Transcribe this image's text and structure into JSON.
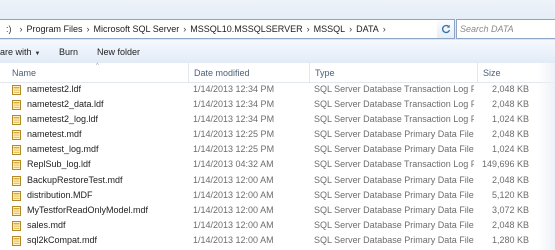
{
  "address": {
    "crumbs": [
      "Program Files",
      "Microsoft SQL Server",
      "MSSQL10.MSSQLSERVER",
      "MSSQL",
      "DATA"
    ],
    "search_placeholder": "Search DATA"
  },
  "toolbar": {
    "share_label": "are with",
    "burn_label": "Burn",
    "new_folder_label": "New folder"
  },
  "columns": {
    "name": "Name",
    "date": "Date modified",
    "type": "Type",
    "size": "Size"
  },
  "files": [
    {
      "name": "nametest2.ldf",
      "date": "1/14/2013 12:34 PM",
      "type": "SQL Server Database Transaction Log File",
      "size": "2,048 KB"
    },
    {
      "name": "nametest2_data.ldf",
      "date": "1/14/2013 12:34 PM",
      "type": "SQL Server Database Transaction Log File",
      "size": "2,048 KB"
    },
    {
      "name": "nametest2_log.ldf",
      "date": "1/14/2013 12:34 PM",
      "type": "SQL Server Database Transaction Log File",
      "size": "1,024 KB"
    },
    {
      "name": "nametest.mdf",
      "date": "1/14/2013 12:25 PM",
      "type": "SQL Server Database Primary Data File",
      "size": "2,048 KB"
    },
    {
      "name": "nametest_log.mdf",
      "date": "1/14/2013 12:25 PM",
      "type": "SQL Server Database Primary Data File",
      "size": "1,024 KB"
    },
    {
      "name": "ReplSub_log.ldf",
      "date": "1/14/2013 04:32 AM",
      "type": "SQL Server Database Transaction Log File",
      "size": "149,696 KB"
    },
    {
      "name": "BackupRestoreTest.mdf",
      "date": "1/14/2013 12:00 AM",
      "type": "SQL Server Database Primary Data File",
      "size": "2,048 KB"
    },
    {
      "name": "distribution.MDF",
      "date": "1/14/2013 12:00 AM",
      "type": "SQL Server Database Primary Data File",
      "size": "5,120 KB"
    },
    {
      "name": "MyTestforReadOnlyModel.mdf",
      "date": "1/14/2013 12:00 AM",
      "type": "SQL Server Database Primary Data File",
      "size": "3,072 KB"
    },
    {
      "name": "sales.mdf",
      "date": "1/14/2013 12:00 AM",
      "type": "SQL Server Database Primary Data File",
      "size": "2,048 KB"
    },
    {
      "name": "sql2kCompat.mdf",
      "date": "1/14/2013 12:00 AM",
      "type": "SQL Server Database Primary Data File",
      "size": "1,280 KB"
    }
  ],
  "icons": {
    "file": "sql-database-file-icon",
    "search": "search-icon",
    "refresh": "refresh-icon"
  },
  "colors": {
    "chrome_top": "#eef3fa",
    "chrome_bottom": "#dbe6f4",
    "secondary_text": "#6d6d6d",
    "header_text": "#4c607a"
  }
}
